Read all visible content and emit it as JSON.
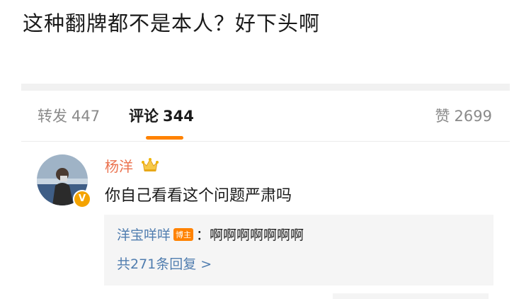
{
  "caption": "这种翻牌都不是本人？好下头啊",
  "tabs": {
    "repost": {
      "label": "转发",
      "count": "447"
    },
    "comments": {
      "label": "评论",
      "count": "344"
    },
    "likes": {
      "label": "赞",
      "count": "2699"
    }
  },
  "accent_color": "#ff8200",
  "link_color": "#507daf",
  "comment": {
    "username": "杨洋",
    "verified_badge": "V",
    "text": "你自己看看这个问题严肃吗",
    "reply": {
      "username": "洋宝咩咩",
      "badge": "博主",
      "colon": "：",
      "text": "啊啊啊啊啊啊啊"
    },
    "more_replies": "共271条回复 >"
  }
}
